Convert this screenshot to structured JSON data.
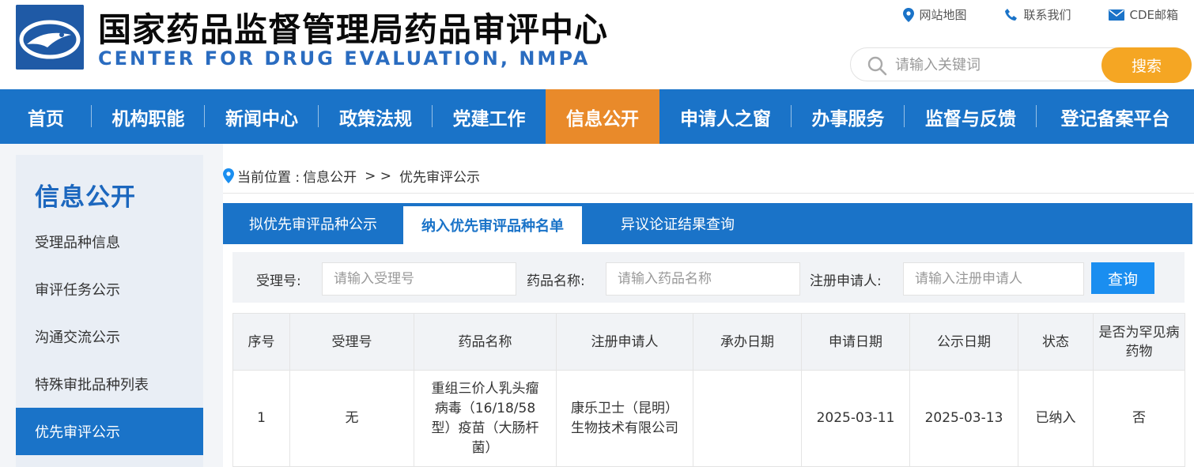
{
  "header": {
    "title": "国家药品监督管理局药品审评中心",
    "subtitle": "CENTER FOR DRUG EVALUATION, NMPA",
    "links": [
      {
        "icon": "location-pin-icon",
        "label": "网站地图"
      },
      {
        "icon": "phone-icon",
        "label": "联系我们"
      },
      {
        "icon": "mail-icon",
        "label": "CDE邮箱"
      }
    ],
    "search": {
      "placeholder": "请输入关键词",
      "button": "搜索"
    }
  },
  "nav": {
    "items": [
      "首页",
      "机构职能",
      "新闻中心",
      "政策法规",
      "党建工作",
      "信息公开",
      "申请人之窗",
      "办事服务",
      "监督与反馈",
      "登记备案平台"
    ],
    "active": "信息公开"
  },
  "sidebar": {
    "title": "信息公开",
    "items": [
      "受理品种信息",
      "审评任务公示",
      "沟通交流公示",
      "特殊审批品种列表",
      "优先审评公示"
    ],
    "active": "优先审评公示"
  },
  "breadcrumb": {
    "prefix": "当前位置 : ",
    "section": "信息公开",
    "separator": "> >",
    "current": "优先审评公示"
  },
  "tabs": {
    "items": [
      "拟优先审评品种公示",
      "纳入优先审评品种名单",
      "异议论证结果查询"
    ],
    "active": "纳入优先审评品种名单"
  },
  "filter": {
    "fields": [
      {
        "label": "受理号:",
        "placeholder": "请输入受理号"
      },
      {
        "label": "药品名称:",
        "placeholder": "请输入药品名称"
      },
      {
        "label": "注册申请人:",
        "placeholder": "请输入注册申请人"
      }
    ],
    "button": "查询"
  },
  "table": {
    "headers": [
      "序号",
      "受理号",
      "药品名称",
      "注册申请人",
      "承办日期",
      "申请日期",
      "公示日期",
      "状态",
      "是否为罕见病药物"
    ],
    "rows": [
      [
        "1",
        "无",
        "重组三价人乳头瘤病毒（16/18/58型）疫苗（大肠杆菌）",
        "康乐卫士（昆明）生物技术有限公司",
        "",
        "2025-03-11",
        "2025-03-13",
        "已纳入",
        "否"
      ]
    ]
  },
  "colors": {
    "nav_blue": "#1a73c8",
    "accent_orange": "#e98a2a",
    "search_orange": "#f5a623",
    "query_blue": "#1a8ef0"
  }
}
